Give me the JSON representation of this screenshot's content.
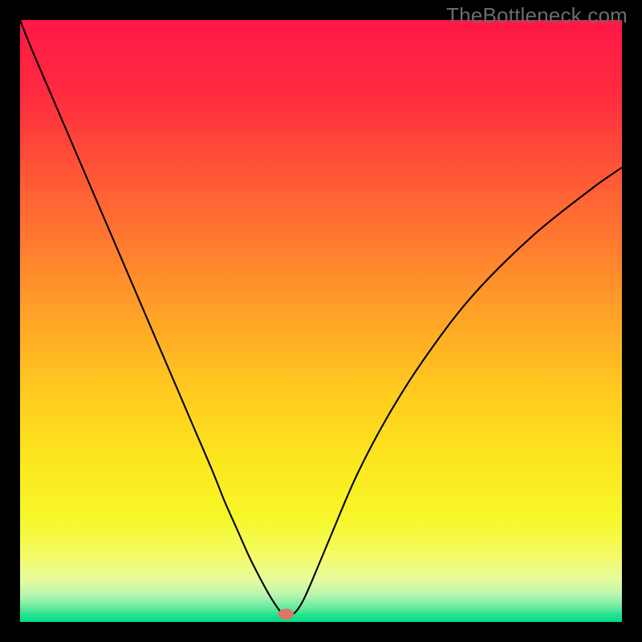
{
  "watermark": "TheBottleneck.com",
  "chart_data": {
    "type": "line",
    "title": "",
    "xlabel": "",
    "ylabel": "",
    "xlim": [
      0,
      100
    ],
    "ylim": [
      0,
      100
    ],
    "grid": false,
    "legend": {
      "visible": false
    },
    "background": {
      "type": "vertical-gradient",
      "stops": [
        {
          "pos": 0.0,
          "color": "#ff1846"
        },
        {
          "pos": 0.12,
          "color": "#ff2a3f"
        },
        {
          "pos": 0.25,
          "color": "#ff5536"
        },
        {
          "pos": 0.38,
          "color": "#ff7e2f"
        },
        {
          "pos": 0.5,
          "color": "#ffa627"
        },
        {
          "pos": 0.62,
          "color": "#ffcb1f"
        },
        {
          "pos": 0.74,
          "color": "#fce81e"
        },
        {
          "pos": 0.83,
          "color": "#f6f72a"
        },
        {
          "pos": 0.89,
          "color": "#f4fb66"
        },
        {
          "pos": 0.93,
          "color": "#e7fb9e"
        },
        {
          "pos": 0.955,
          "color": "#b6f5b0"
        },
        {
          "pos": 0.975,
          "color": "#6beba1"
        },
        {
          "pos": 0.99,
          "color": "#1de28f"
        },
        {
          "pos": 1.0,
          "color": "#00dd85"
        }
      ]
    },
    "series": [
      {
        "name": "bottleneck-curve",
        "stroke": "#000000",
        "stroke_width": 2.1,
        "x": [
          0,
          2,
          5,
          8,
          11,
          14,
          17,
          20,
          23,
          26,
          29,
          32,
          34,
          36,
          38,
          39.5,
          41,
          42.2,
          43.2,
          44,
          45.5,
          47,
          49,
          52,
          56,
          61,
          67,
          75,
          85,
          95,
          100
        ],
        "y": [
          100,
          95,
          88,
          81,
          74,
          67,
          60,
          53,
          46,
          39,
          32,
          25,
          20,
          15.5,
          11,
          8,
          5.2,
          3.2,
          1.8,
          1.2,
          1.4,
          3.5,
          8,
          15.2,
          24.5,
          34,
          43.5,
          54,
          64,
          72,
          75.5
        ]
      }
    ],
    "marker": {
      "name": "min-point",
      "x": 44.2,
      "y": 1.3,
      "rx": 1.3,
      "ry": 0.9,
      "fill": "#e0746b"
    }
  }
}
